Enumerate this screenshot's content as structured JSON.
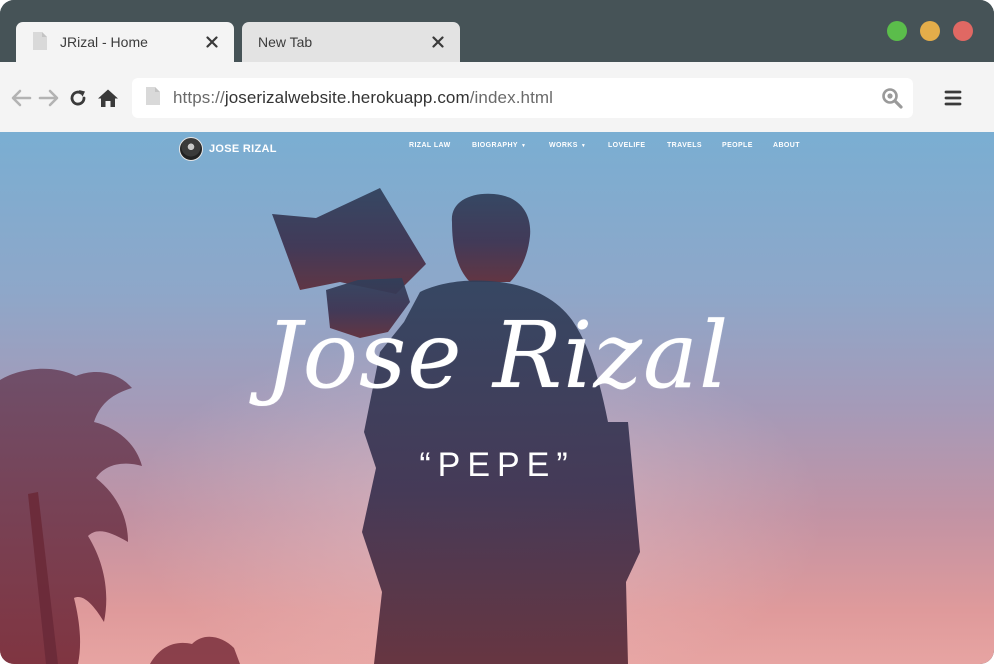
{
  "browser": {
    "tabs": [
      {
        "title": "JRizal - Home",
        "active": true
      },
      {
        "title": "New Tab",
        "active": false
      }
    ],
    "close_glyph": "✕",
    "url_scheme": "https://",
    "url_host": "joserizalwebsite.herokuapp.com",
    "url_path": "/index.html",
    "window_controls": {
      "green": "#5bbd4b",
      "yellow": "#e4ad4a",
      "red": "#e06863"
    },
    "icons": [
      "page-icon",
      "back-arrow-icon",
      "forward-arrow-icon",
      "reload-icon",
      "home-icon",
      "search-icon",
      "hamburger-menu-icon"
    ]
  },
  "site": {
    "brand": "JOSE RIZAL",
    "nav": [
      {
        "label": "RIZAL LAW",
        "dropdown": false
      },
      {
        "label": "BIOGRAPHY",
        "dropdown": true
      },
      {
        "label": "WORKS",
        "dropdown": true
      },
      {
        "label": "LOVELIFE",
        "dropdown": false
      },
      {
        "label": "TRAVELS",
        "dropdown": false
      },
      {
        "label": "PEOPLE",
        "dropdown": false
      },
      {
        "label": "ABOUT",
        "dropdown": false
      }
    ],
    "caret_glyph": "▼",
    "hero_title": "Jose Rizal",
    "hero_subtitle": "“PEPE”"
  },
  "colors": {
    "chrome_dark": "#465357",
    "chrome_light": "#f4f4f4",
    "sky_top": "#7aaed2",
    "sky_bottom": "#e7a4a2",
    "silhouette": "#3e3452"
  }
}
